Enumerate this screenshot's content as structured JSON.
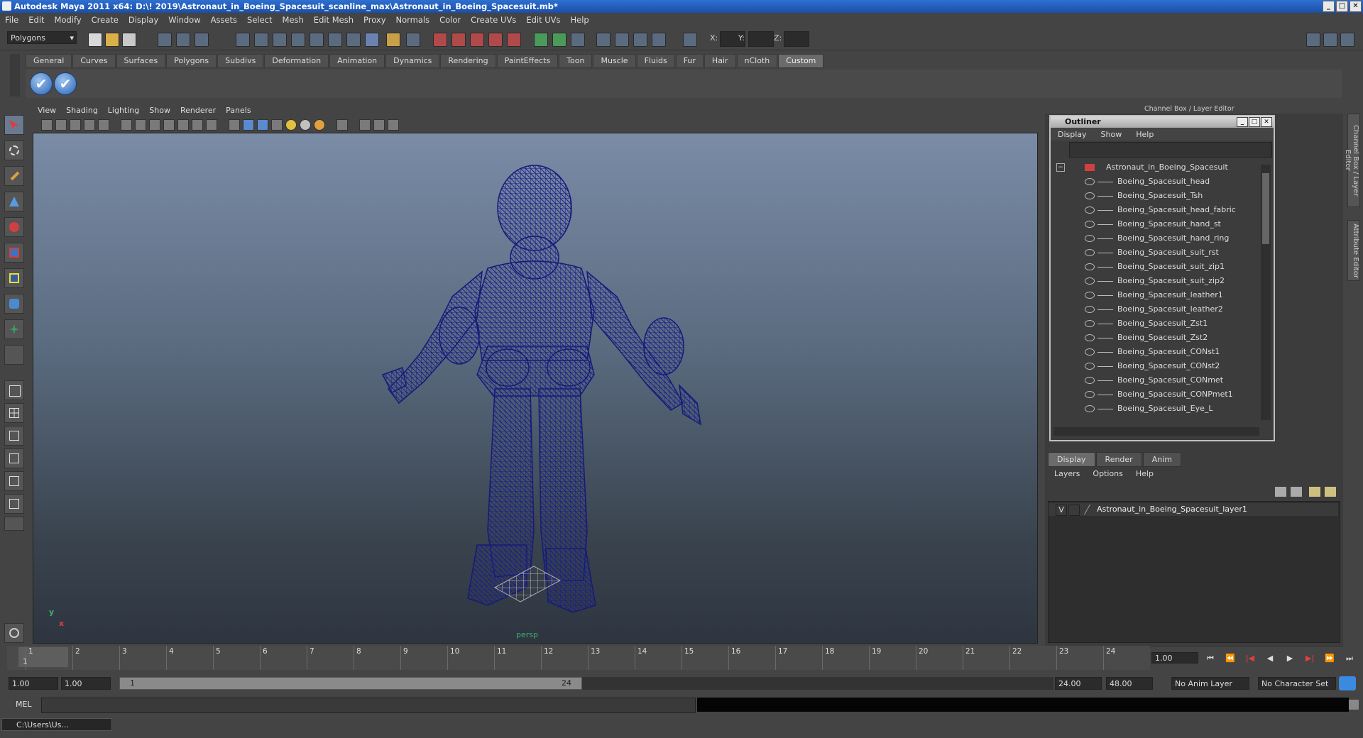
{
  "titlebar": {
    "title": "Autodesk Maya 2011 x64: D:\\! 2019\\Astronaut_in_Boeing_Spacesuit_scanline_max\\Astronaut_in_Boeing_Spacesuit.mb*",
    "buttons": [
      "_",
      "□",
      "✕"
    ]
  },
  "menubar": [
    "File",
    "Edit",
    "Modify",
    "Create",
    "Display",
    "Window",
    "Assets",
    "Select",
    "Mesh",
    "Edit Mesh",
    "Proxy",
    "Normals",
    "Color",
    "Create UVs",
    "Edit UVs",
    "Help"
  ],
  "statusline": {
    "mode": "Polygons",
    "x_label": "X:",
    "y_label": "Y:",
    "z_label": "Z:"
  },
  "shelf": {
    "tabs": [
      "General",
      "Curves",
      "Surfaces",
      "Polygons",
      "Subdivs",
      "Deformation",
      "Animation",
      "Dynamics",
      "Rendering",
      "PaintEffects",
      "Toon",
      "Muscle",
      "Fluids",
      "Fur",
      "Hair",
      "nCloth",
      "Custom"
    ],
    "active_tab": "Custom"
  },
  "viewport": {
    "menu": [
      "View",
      "Shading",
      "Lighting",
      "Show",
      "Renderer",
      "Panels"
    ],
    "camera": "persp",
    "axis_y": "y",
    "axis_x": "x",
    "wire_color": "#1a1f8c"
  },
  "channelbox": {
    "header": "Channel Box / Layer Editor",
    "side_tabs": [
      "Channel Box / Layer Editor",
      "Attribute Editor"
    ]
  },
  "outliner": {
    "title": "Outliner",
    "menu": [
      "Display",
      "Show",
      "Help"
    ],
    "root": "Astronaut_in_Boeing_Spacesuit",
    "items": [
      "Boeing_Spacesuit_head",
      "Boeing_Spacesuit_Tsh",
      "Boeing_Spacesuit_head_fabric",
      "Boeing_Spacesuit_hand_st",
      "Boeing_Spacesuit_hand_ring",
      "Boeing_Spacesuit_suit_rst",
      "Boeing_Spacesuit_suit_zip1",
      "Boeing_Spacesuit_suit_zip2",
      "Boeing_Spacesuit_leather1",
      "Boeing_Spacesuit_leather2",
      "Boeing_Spacesuit_Zst1",
      "Boeing_Spacesuit_Zst2",
      "Boeing_Spacesuit_CONst1",
      "Boeing_Spacesuit_CONst2",
      "Boeing_Spacesuit_CONmet",
      "Boeing_Spacesuit_CONPmet1",
      "Boeing_Spacesuit_Eye_L"
    ]
  },
  "layer_editor": {
    "tabs": [
      "Display",
      "Render",
      "Anim"
    ],
    "active_tab": "Display",
    "menu": [
      "Layers",
      "Options",
      "Help"
    ],
    "layer_visible": "V",
    "layer_name": "Astronaut_in_Boeing_Spacesuit_layer1"
  },
  "timeline": {
    "ticks": [
      "1",
      "2",
      "3",
      "4",
      "5",
      "6",
      "7",
      "8",
      "9",
      "10",
      "11",
      "12",
      "13",
      "14",
      "15",
      "16",
      "17",
      "18",
      "19",
      "20",
      "21",
      "22",
      "23",
      "24"
    ],
    "current_frame_label": "1",
    "current_frame": "1.00"
  },
  "range": {
    "start": "1.00",
    "playback_start": "1.00",
    "slider_start": "1",
    "slider_end": "24",
    "playback_end": "24.00",
    "end": "48.00",
    "anim_layer": "No Anim Layer",
    "character_set": "No Character Set"
  },
  "commandline": {
    "label": "MEL"
  },
  "taskbar": {
    "item": "C:\\Users\\Us..."
  }
}
